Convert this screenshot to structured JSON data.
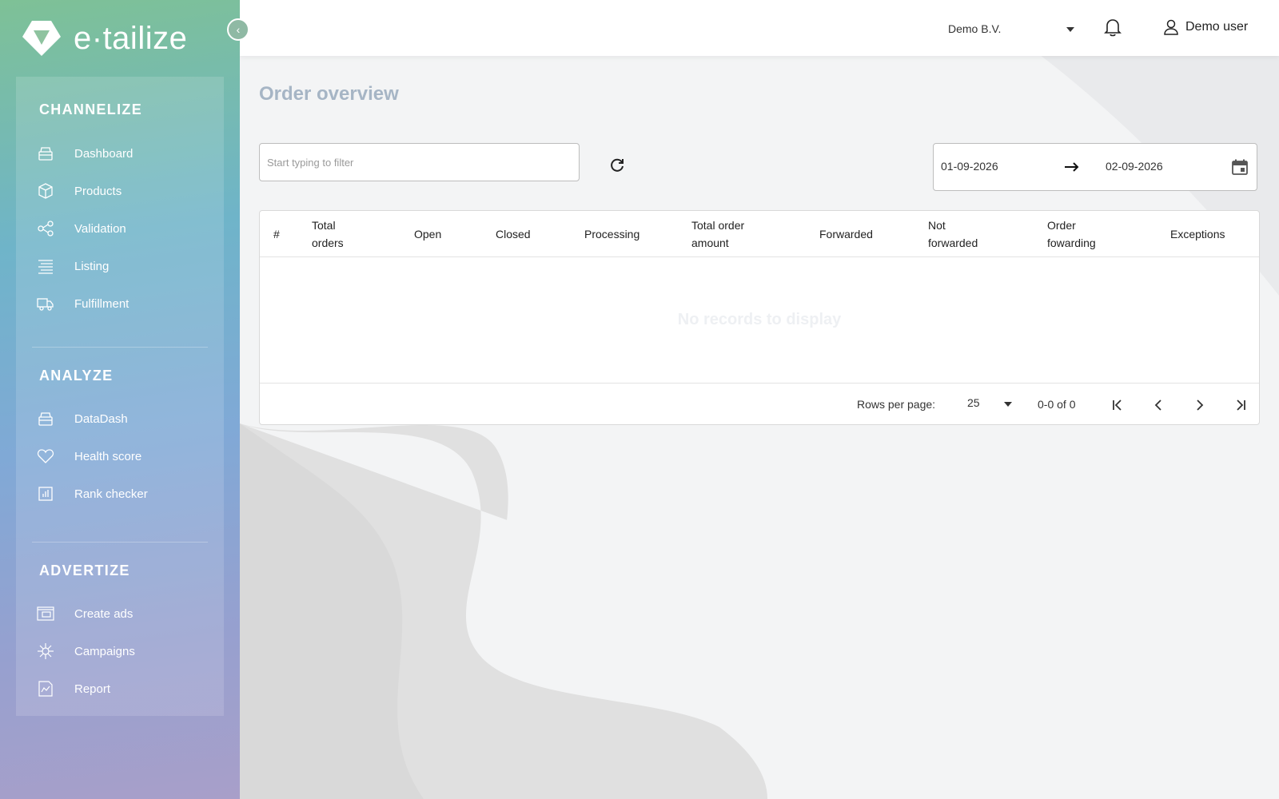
{
  "brand": {
    "logo_text": "e·tailize"
  },
  "sidebar": {
    "sections": [
      {
        "title": "CHANNELIZE",
        "items": [
          {
            "label": "Dashboard",
            "icon": "archive-icon"
          },
          {
            "label": "Products",
            "icon": "box-icon"
          },
          {
            "label": "Validation",
            "icon": "share-nodes-icon"
          },
          {
            "label": "Listing",
            "icon": "list-lines-icon"
          },
          {
            "label": "Fulfillment",
            "icon": "truck-icon"
          }
        ]
      },
      {
        "title": "ANALYZE",
        "items": [
          {
            "label": "DataDash",
            "icon": "archive-icon"
          },
          {
            "label": "Health score",
            "icon": "heart-icon"
          },
          {
            "label": "Rank checker",
            "icon": "bar-chart-icon"
          }
        ]
      },
      {
        "title": "ADVERTIZE",
        "items": [
          {
            "label": "Create ads",
            "icon": "ads-icon"
          },
          {
            "label": "Campaigns",
            "icon": "target-icon"
          },
          {
            "label": "Report",
            "icon": "report-icon"
          }
        ]
      }
    ]
  },
  "header": {
    "company": "Demo B.V.",
    "user": "Demo user"
  },
  "main": {
    "title": "Order overview",
    "filter_placeholder": "Start typing to filter",
    "date_from": "01-09-2026",
    "date_to": "02-09-2026",
    "table": {
      "columns": [
        "#",
        "Total\norders",
        "Open",
        "Closed",
        "Processing",
        "Total order\namount",
        "Forwarded",
        "Not\nforwarded",
        "Order\nfowarding",
        "Exceptions"
      ],
      "rows": [],
      "empty_text": "No records to display"
    },
    "pagination": {
      "rows_per_page_label": "Rows per page:",
      "rows_per_page": "25",
      "range": "0-0 of 0"
    }
  },
  "colors": {
    "sidebar_gradient": [
      "#7ec196",
      "#6fb4c9",
      "#80a9d6",
      "#a89fc9"
    ],
    "page_title": "#a6b5c5"
  }
}
